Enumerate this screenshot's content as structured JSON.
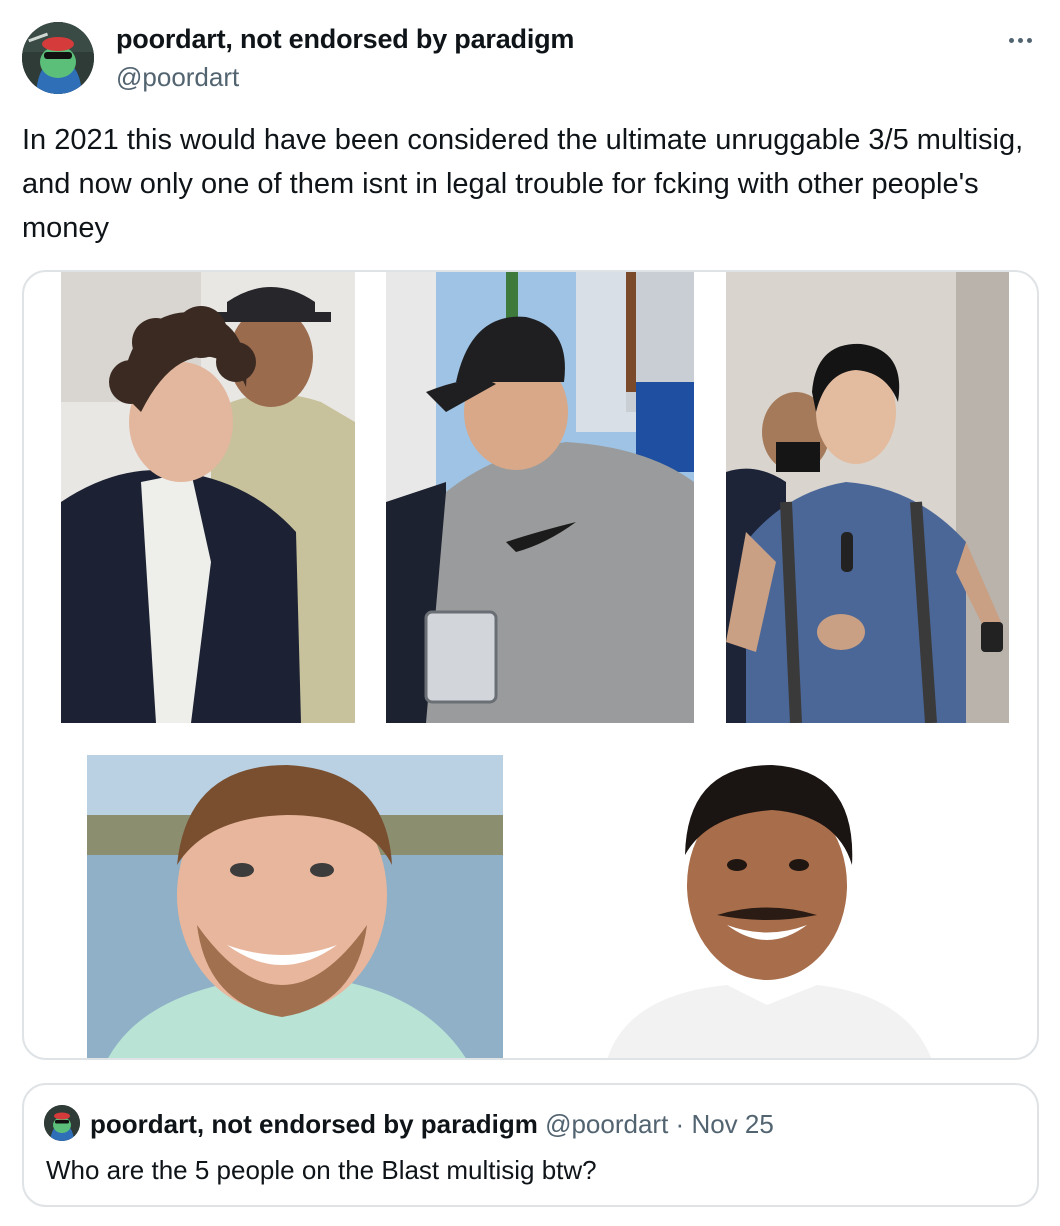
{
  "author": {
    "display_name": "poordart, not endorsed by paradigm",
    "handle": "@poordart"
  },
  "tweet": {
    "text": "In 2021 this would have been considered the ultimate unruggable 3/5 multisig, and now only one of them isnt in legal trouble for fcking with other people's money"
  },
  "media": {
    "photos": [
      {
        "name": "photo-1",
        "subject": "curly-haired man in suit escorted by officer"
      },
      {
        "name": "photo-2",
        "subject": "man in black cap and grey sweatshirt"
      },
      {
        "name": "photo-3",
        "subject": "man in blue t-shirt with backpack"
      },
      {
        "name": "photo-4",
        "subject": "smiling man by a lake"
      },
      {
        "name": "photo-5",
        "subject": "smiling man with mustache"
      }
    ]
  },
  "quoted_tweet": {
    "display_name": "poordart, not endorsed by paradigm",
    "handle": "@poordart",
    "separator": "·",
    "date": "Nov 25",
    "text": "Who are the 5 people on the Blast multisig btw?"
  },
  "icons": {
    "more": "more-options-icon"
  },
  "colors": {
    "text": "#0f1419",
    "secondary": "#536471",
    "border": "#dfe3e6"
  }
}
